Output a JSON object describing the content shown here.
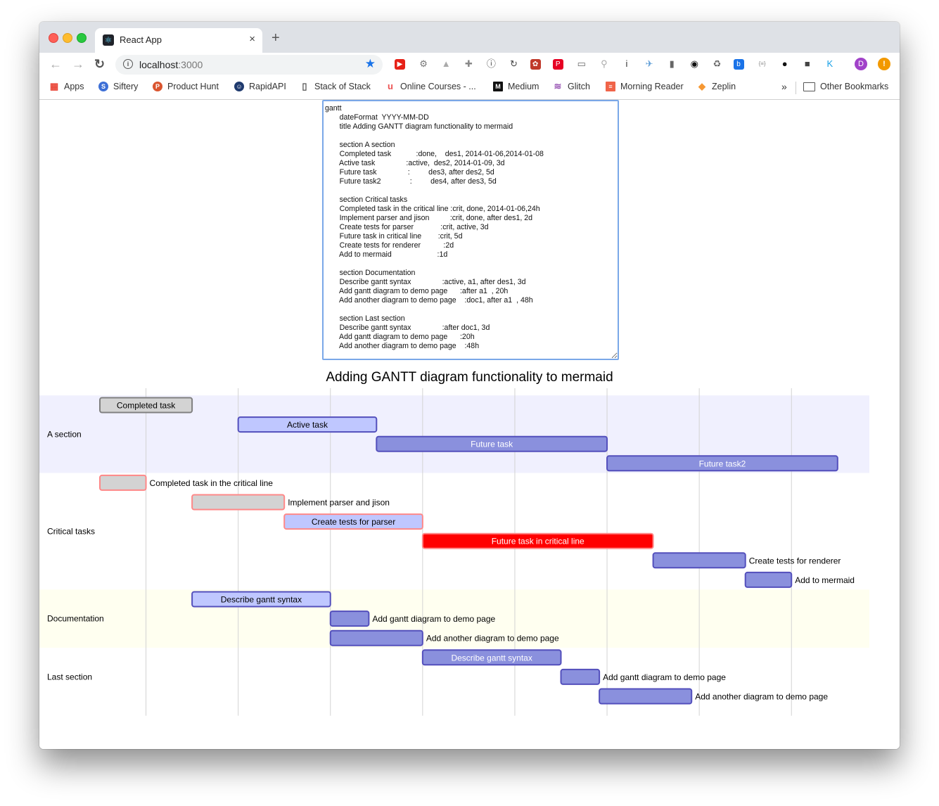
{
  "browser": {
    "tab_title": "React App",
    "tab_close": "×",
    "new_tab": "+",
    "url_host": "localhost",
    "url_port": ":3000",
    "nav": {
      "back": "←",
      "forward": "→",
      "reload": "↻"
    },
    "extensions": [
      "video-ext",
      "settings-ext",
      "drive-ext",
      "puzzle-ext",
      "info-ext",
      "sync-ext",
      "dog-ext",
      "pinterest-ext",
      "cast-ext",
      "search-ext",
      "info2-ext",
      "ufo-ext",
      "panel-ext",
      "eye-ext",
      "recycle-ext",
      "p-ext",
      "json-ext",
      "dot-ext",
      "camera-ext",
      "k-ext"
    ],
    "profile_initial": "D",
    "alert_badge": "!"
  },
  "bookmarks": [
    {
      "label": "Apps",
      "icon": "apps-grid-icon"
    },
    {
      "label": "Siftery",
      "icon": "siftery-icon"
    },
    {
      "label": "Product Hunt",
      "icon": "product-hunt-icon"
    },
    {
      "label": "RapidAPI",
      "icon": "rapidapi-icon"
    },
    {
      "label": "Stack of Stack",
      "icon": "page-icon"
    },
    {
      "label": "Online Courses - ...",
      "icon": "udemy-icon"
    },
    {
      "label": "Medium",
      "icon": "medium-icon"
    },
    {
      "label": "Glitch",
      "icon": "glitch-icon"
    },
    {
      "label": "Morning Reader",
      "icon": "morning-reader-icon"
    },
    {
      "label": "Zeplin",
      "icon": "zeplin-icon"
    }
  ],
  "bookmarks_overflow": "»",
  "other_bookmarks": "Other Bookmarks",
  "editor_text": "gantt\n       dateFormat  YYYY-MM-DD\n       title Adding GANTT diagram functionality to mermaid\n\n       section A section\n       Completed task            :done,    des1, 2014-01-06,2014-01-08\n       Active task               :active,  des2, 2014-01-09, 3d\n       Future task               :         des3, after des2, 5d\n       Future task2              :         des4, after des3, 5d\n\n       section Critical tasks\n       Completed task in the critical line :crit, done, 2014-01-06,24h\n       Implement parser and jison          :crit, done, after des1, 2d\n       Create tests for parser             :crit, active, 3d\n       Future task in critical line        :crit, 5d\n       Create tests for renderer           :2d\n       Add to mermaid                      :1d\n\n       section Documentation\n       Describe gantt syntax               :active, a1, after des1, 3d\n       Add gantt diagram to demo page      :after a1  , 20h\n       Add another diagram to demo page    :doc1, after a1  , 48h\n\n       section Last section\n       Describe gantt syntax               :after doc1, 3d\n       Add gantt diagram to demo page      :20h\n       Add another diagram to demo page    :48h",
  "chart_data": {
    "type": "gantt",
    "title": "Adding GANTT diagram functionality to mermaid",
    "date_format": "YYYY-MM-DD",
    "x_range": [
      "2014-01-06T00:00",
      "2014-01-22T00:00"
    ],
    "x_ticks": [
      "2014-01-07",
      "2014-01-09",
      "2014-01-11",
      "2014-01-13",
      "2014-01-15",
      "2014-01-17",
      "2014-01-19",
      "2014-01-21"
    ],
    "sections": [
      {
        "name": "A section",
        "color": "#f0f0fe",
        "tasks": [
          {
            "label": "Completed task",
            "start": "2014-01-06T00:00",
            "end": "2014-01-08T00:00",
            "status": "done",
            "crit": false
          },
          {
            "label": "Active task",
            "start": "2014-01-09T00:00",
            "end": "2014-01-12T00:00",
            "status": "active",
            "crit": false
          },
          {
            "label": "Future task",
            "start": "2014-01-12T00:00",
            "end": "2014-01-17T00:00",
            "status": "future",
            "crit": false
          },
          {
            "label": "Future task2",
            "start": "2014-01-17T00:00",
            "end": "2014-01-22T00:00",
            "status": "future",
            "crit": false
          }
        ]
      },
      {
        "name": "Critical tasks",
        "color": "#ffffff",
        "tasks": [
          {
            "label": "Completed task in the critical line",
            "start": "2014-01-06T00:00",
            "end": "2014-01-07T00:00",
            "status": "done",
            "crit": true
          },
          {
            "label": "Implement parser and jison",
            "start": "2014-01-08T00:00",
            "end": "2014-01-10T00:00",
            "status": "done",
            "crit": true
          },
          {
            "label": "Create tests for parser",
            "start": "2014-01-10T00:00",
            "end": "2014-01-13T00:00",
            "status": "active",
            "crit": true
          },
          {
            "label": "Future task in critical line",
            "start": "2014-01-13T00:00",
            "end": "2014-01-18T00:00",
            "status": "future",
            "crit": true
          },
          {
            "label": "Create tests for renderer",
            "start": "2014-01-18T00:00",
            "end": "2014-01-20T00:00",
            "status": "future",
            "crit": false
          },
          {
            "label": "Add to mermaid",
            "start": "2014-01-20T00:00",
            "end": "2014-01-21T00:00",
            "status": "future",
            "crit": false
          }
        ]
      },
      {
        "name": "Documentation",
        "color": "#fffff0",
        "tasks": [
          {
            "label": "Describe gantt syntax",
            "start": "2014-01-08T00:00",
            "end": "2014-01-11T00:00",
            "status": "active",
            "crit": false
          },
          {
            "label": "Add gantt diagram to demo page",
            "start": "2014-01-11T00:00",
            "end": "2014-01-11T20:00",
            "status": "future",
            "crit": false
          },
          {
            "label": "Add another diagram to demo page",
            "start": "2014-01-11T00:00",
            "end": "2014-01-13T00:00",
            "status": "future",
            "crit": false
          }
        ]
      },
      {
        "name": "Last section",
        "color": "#ffffff",
        "tasks": [
          {
            "label": "Describe gantt syntax",
            "start": "2014-01-13T00:00",
            "end": "2014-01-16T00:00",
            "status": "future",
            "crit": false
          },
          {
            "label": "Add gantt diagram to demo page",
            "start": "2014-01-16T00:00",
            "end": "2014-01-16T20:00",
            "status": "future",
            "crit": false
          },
          {
            "label": "Add another diagram to demo page",
            "start": "2014-01-16T20:00",
            "end": "2014-01-18T20:00",
            "status": "future",
            "crit": false
          }
        ]
      }
    ],
    "colors": {
      "done_fill": "#d3d3d3",
      "done_stroke": "#808080",
      "active_fill": "#bfc7ff",
      "active_stroke": "#534fbc",
      "future_fill": "#8a90dd",
      "future_stroke": "#534fbc",
      "crit_stroke": "#ff8888",
      "crit_future_fill": "#ff0000",
      "grid": "#d3d3d3",
      "tick_text": "#a9a9a9"
    }
  }
}
